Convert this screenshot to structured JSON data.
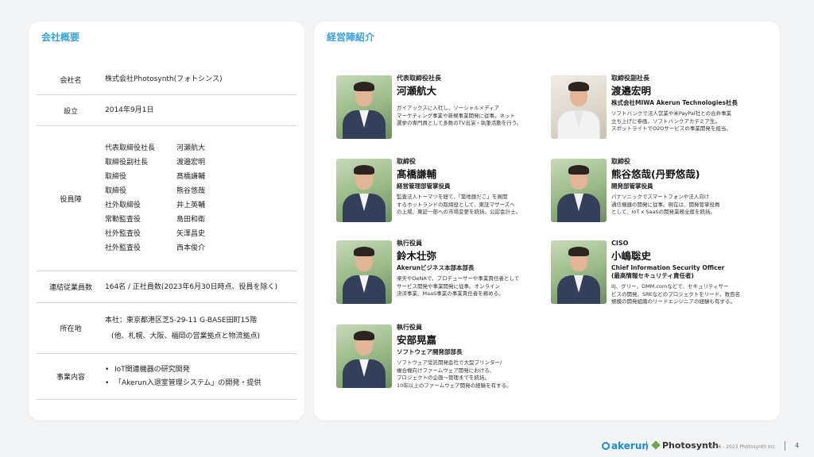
{
  "left": {
    "title": "会社概要",
    "company_label": "会社名",
    "company_value": "株式会社Photosynth(フォトシンス)",
    "founded_label": "設立",
    "founded_value": "2014年9月1日",
    "officers_label": "役員陣",
    "officers": [
      {
        "role": "代表取締役社長",
        "name": "河瀬航大"
      },
      {
        "role": "取締役副社長",
        "name": "渡邉宏明"
      },
      {
        "role": "取締役",
        "name": "髙橋謙輔"
      },
      {
        "role": "取締役",
        "name": "熊谷悠哉"
      },
      {
        "role": "社外取締役",
        "name": "井上英輔"
      },
      {
        "role": "常勤監査役",
        "name": "島田和衛"
      },
      {
        "role": "社外監査役",
        "name": "矢澤昌史"
      },
      {
        "role": "社外監査役",
        "name": "西本俊介"
      }
    ],
    "employees_label": "連結従業員数",
    "employees_value": "164名 / 正社員数(2023年6月30日時点、役員を除く)",
    "location_label": "所在地",
    "location_line1": "本社：東京都港区芝5-29-11 G-BASE田町15階",
    "location_line2": "(他、札幌、大阪、福岡の営業拠点と物流拠点)",
    "business_label": "事業内容",
    "business_items": [
      "IoT関連機器の研究開発",
      "「Akerun入退室管理システム」の開発・提供"
    ]
  },
  "right": {
    "title": "経営陣紹介",
    "executives": [
      {
        "role": "代表取締役社長",
        "name": "河瀬航大",
        "sub": "",
        "desc": "ガイアックスに入社し、ソーシャルメディア\nマーケティング事業や新規事業開発に従事。ネット\n選挙の専門員として多数のTV出演・執筆活動を行う。"
      },
      {
        "role": "取締役副社長",
        "name": "渡邉宏明",
        "sub": "株式会社MIWA Akerun Technologies社長",
        "desc": "ソフトバンクで法人営業や米PayPal社との合弁事業\n立ち上げに参画。ソフトバンクアカデミア生。\nスポットライトでO2Oサービスの事業開発を担当。"
      },
      {
        "role": "取締役",
        "name": "髙橋謙輔",
        "sub": "経営管理部管掌役員",
        "desc": "監査法人トーマツを経て、「築地銀だこ」を展開\nするホットランドの取締役として、東証マザーズへ\nの上場、東証一部への市場変更を統括。公認会計士。"
      },
      {
        "role": "取締役",
        "name": "熊谷悠哉(丹野悠哉)",
        "sub": "開発部管掌役員",
        "desc": "パナソニックでスマートフォンや法人向け\n通信機器の開発に従事。現在は、開発管掌役員\nとして、IoT x SaaSの開発業務全般を統括。"
      },
      {
        "role": "執行役員",
        "name": "鈴木壮弥",
        "sub": "Akerunビジネス本部本部長",
        "desc": "楽天やDeNAで、プロデューサーや事業責任者として\nサービス開発や事業開発に従事。オンライン\n決済事業、MaaS事業の事業責任者を務める。"
      },
      {
        "role": "CISO",
        "name": "小嶋聡史",
        "sub": "Chief Information Security Officer\n(最高情報セキュリティ責任者)",
        "desc": "IIJ、グリー、DMM.comなどで、セキュリティサー\nビスの開発、SREなどのプロジェクトをリード。数百名\n規模の開発組織のリードエンジニアの経験も有する。"
      },
      {
        "role": "執行役員",
        "name": "安部晃嘉",
        "sub": "ソフトウェア開発部部長",
        "desc": "ソフトウェア受託開発会社で大型プリンター/\n複合機向けファームウェア開発における、\nプロジェクトの企画〜管理までを統括。\n10年以上のファームウェア開発の経験を有する。"
      }
    ]
  },
  "footer": {
    "akerun": "akerun",
    "photosynth": "Photosynth",
    "copyright": "© 2014 - 2023 Photosynth Inc.",
    "page": "4"
  },
  "colors": {
    "accent": "#3aa0e0",
    "akerun_blue": "#1a8bd6"
  }
}
